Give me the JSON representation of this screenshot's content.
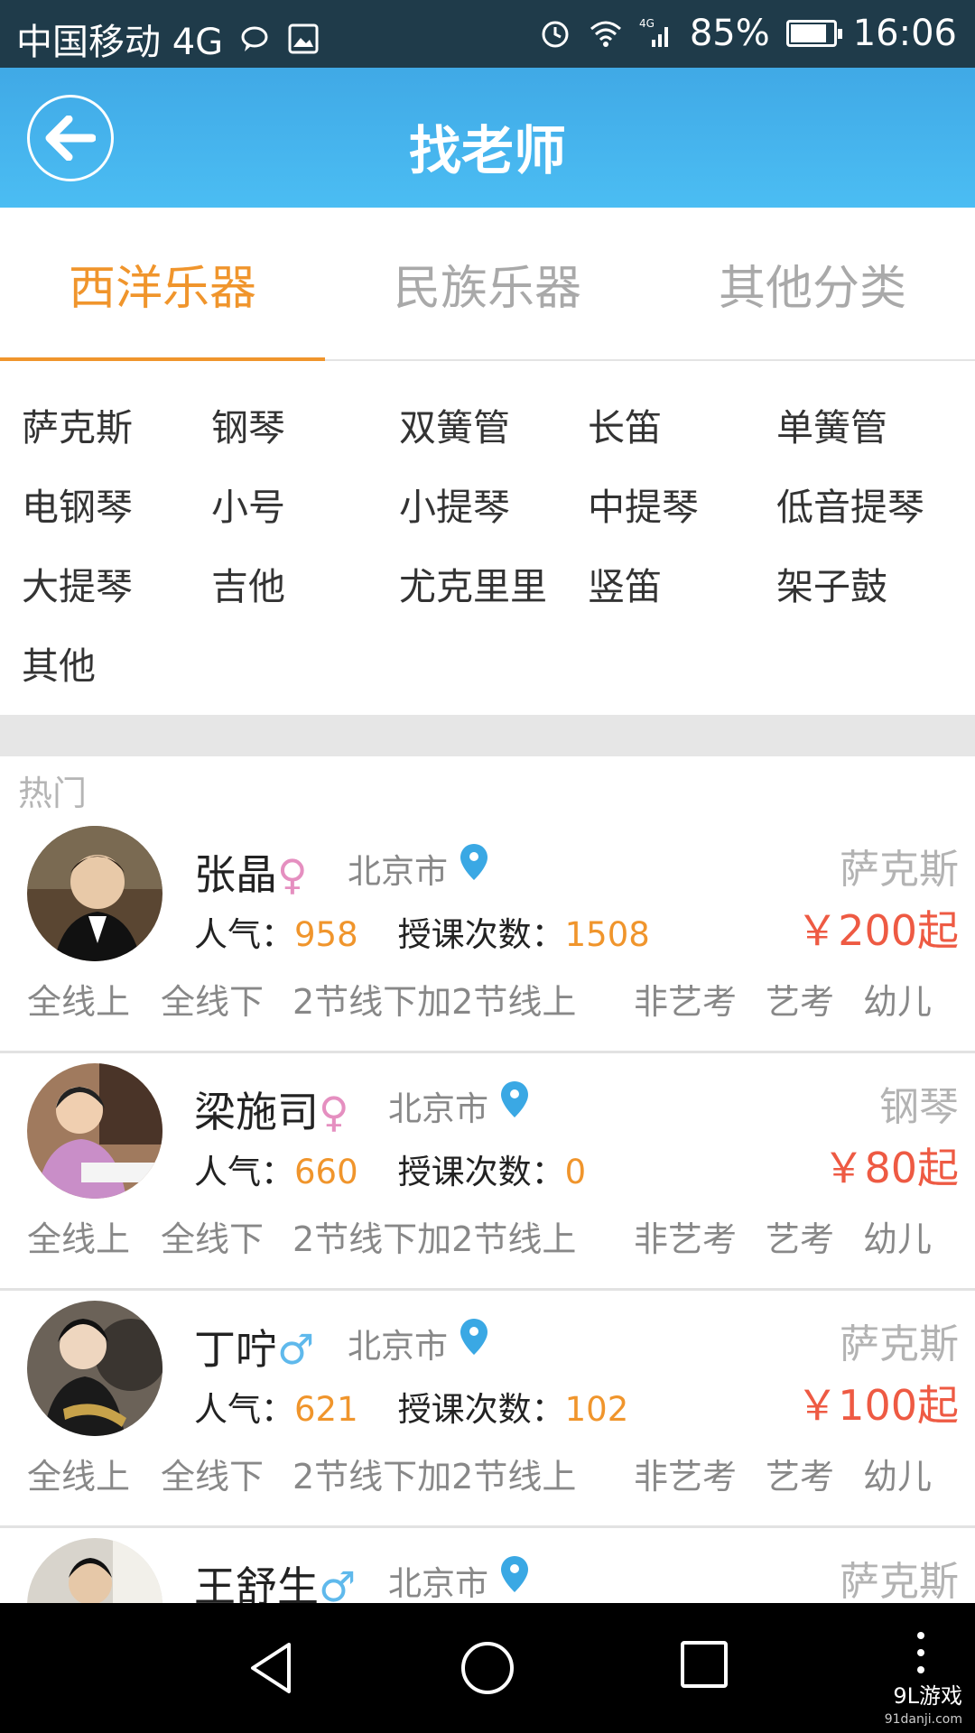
{
  "status_bar": {
    "carrier": "中国移动 4G",
    "network": "4G",
    "battery": "85%",
    "battery_level": 0.85,
    "time": "16:06"
  },
  "header": {
    "title": "找老师",
    "back_icon": "arrow-left-icon",
    "color": "#45b3ee"
  },
  "tabs": [
    {
      "label": "西洋乐器",
      "active": true
    },
    {
      "label": "民族乐器",
      "active": false
    },
    {
      "label": "其他分类",
      "active": false
    }
  ],
  "categories": [
    "萨克斯",
    "钢琴",
    "双簧管",
    "长笛",
    "单簧管",
    "电钢琴",
    "小号",
    "小提琴",
    "中提琴",
    "低音提琴",
    "大提琴",
    "吉他",
    "尤克里里",
    "竖笛",
    "架子鼓",
    "其他"
  ],
  "section_label": "热门",
  "teachers": [
    {
      "name": "张晶",
      "gender": "♀",
      "gender_type": "female",
      "city": "北京市",
      "popularity_label": "人气：",
      "popularity": "958",
      "lessons_label": "授课次数：",
      "lessons": "1508",
      "subject": "萨克斯",
      "price": "￥200起",
      "tags": [
        "全线上",
        "全线下",
        "2节线下加2节线上",
        "非艺考",
        "艺考",
        "幼儿"
      ]
    },
    {
      "name": "梁施司",
      "gender": "♀",
      "gender_type": "female",
      "city": "北京市",
      "popularity_label": "人气：",
      "popularity": "660",
      "lessons_label": "授课次数：",
      "lessons": "0",
      "subject": "钢琴",
      "price": "￥80起",
      "tags": [
        "全线上",
        "全线下",
        "2节线下加2节线上",
        "非艺考",
        "艺考",
        "幼儿"
      ]
    },
    {
      "name": "丁咛",
      "gender": "♂",
      "gender_type": "male",
      "city": "北京市",
      "popularity_label": "人气：",
      "popularity": "621",
      "lessons_label": "授课次数：",
      "lessons": "102",
      "subject": "萨克斯",
      "price": "￥100起",
      "tags": [
        "全线上",
        "全线下",
        "2节线下加2节线上",
        "非艺考",
        "艺考",
        "幼儿"
      ]
    },
    {
      "name": "王舒生",
      "gender": "♂",
      "gender_type": "male",
      "city": "北京市",
      "subject": "萨克斯"
    }
  ],
  "nav": {
    "back_icon": "triangle-back-icon",
    "home_icon": "circle-home-icon",
    "recents_icon": "square-recents-icon",
    "menu_icon": "vertical-dots-icon"
  },
  "watermark": {
    "brand": "9L游戏",
    "url": "91danji.com"
  }
}
